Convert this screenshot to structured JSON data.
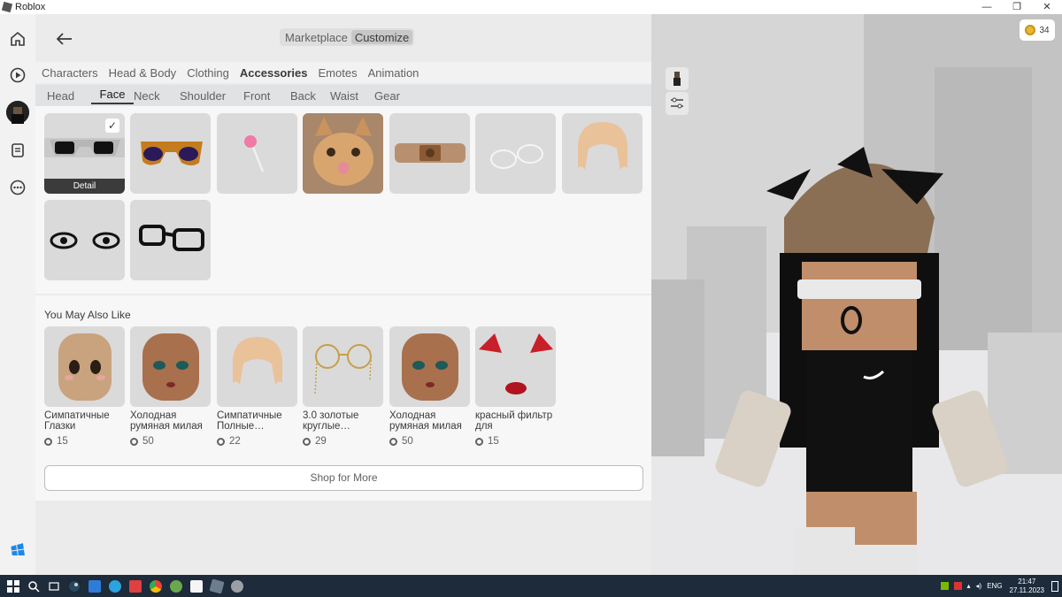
{
  "window": {
    "title": "Roblox",
    "controls": [
      "—",
      "❐",
      "✕"
    ]
  },
  "rail": {
    "icons": [
      "home-icon",
      "play-icon",
      "avatar",
      "chat-icon",
      "more-icon",
      "windows-logo-icon"
    ]
  },
  "header": {
    "segments": [
      {
        "label": "Marketplace",
        "active": false
      },
      {
        "label": "Customize",
        "active": true
      }
    ]
  },
  "categories": [
    {
      "label": "Characters",
      "active": false
    },
    {
      "label": "Head & Body",
      "active": false
    },
    {
      "label": "Clothing",
      "active": false
    },
    {
      "label": "Accessories",
      "active": true
    },
    {
      "label": "Emotes",
      "active": false
    },
    {
      "label": "Animation",
      "active": false
    }
  ],
  "subcategories": [
    {
      "label": "Head",
      "active": false
    },
    {
      "label": "Face",
      "active": true
    },
    {
      "label": "Neck",
      "active": false
    },
    {
      "label": "Shoulder",
      "active": false
    },
    {
      "label": "Front",
      "active": false
    },
    {
      "label": "Back",
      "active": false
    },
    {
      "label": "Waist",
      "active": false
    },
    {
      "label": "Gear",
      "active": false
    }
  ],
  "items": [
    {
      "icon": "white-sunglasses",
      "selected": true,
      "detail_label": "Detail"
    },
    {
      "icon": "orange-purple-sunglasses"
    },
    {
      "icon": "pink-lollipop"
    },
    {
      "icon": "cat-photo"
    },
    {
      "icon": "bear-bandage"
    },
    {
      "icon": "clear-glasses"
    },
    {
      "icon": "blonde-bangs"
    },
    {
      "icon": "spiky-eyelashes"
    },
    {
      "icon": "black-glasses"
    }
  ],
  "recommendations": {
    "title": "You May Also Like",
    "items": [
      {
        "name": "Симпатичные Глазки",
        "price": "15",
        "icon": "cute-eyes-face"
      },
      {
        "name": "Холодная румяная милая",
        "price": "50",
        "icon": "makeup-face"
      },
      {
        "name": "Симпатичные Полные…",
        "price": "22",
        "icon": "blonde-bangs"
      },
      {
        "name": "3.0 золотые круглые…",
        "price": "29",
        "icon": "gold-round-glasses"
      },
      {
        "name": "Холодная румяная милая",
        "price": "50",
        "icon": "makeup-face"
      },
      {
        "name": "красный фильтр для",
        "price": "15",
        "icon": "red-ears-nose"
      }
    ],
    "shop_label": "Shop for More"
  },
  "viewport": {
    "robux_balance": "34"
  },
  "taskbar": {
    "lang": "ENG",
    "time": "21:47",
    "date": "27.11.2023"
  }
}
